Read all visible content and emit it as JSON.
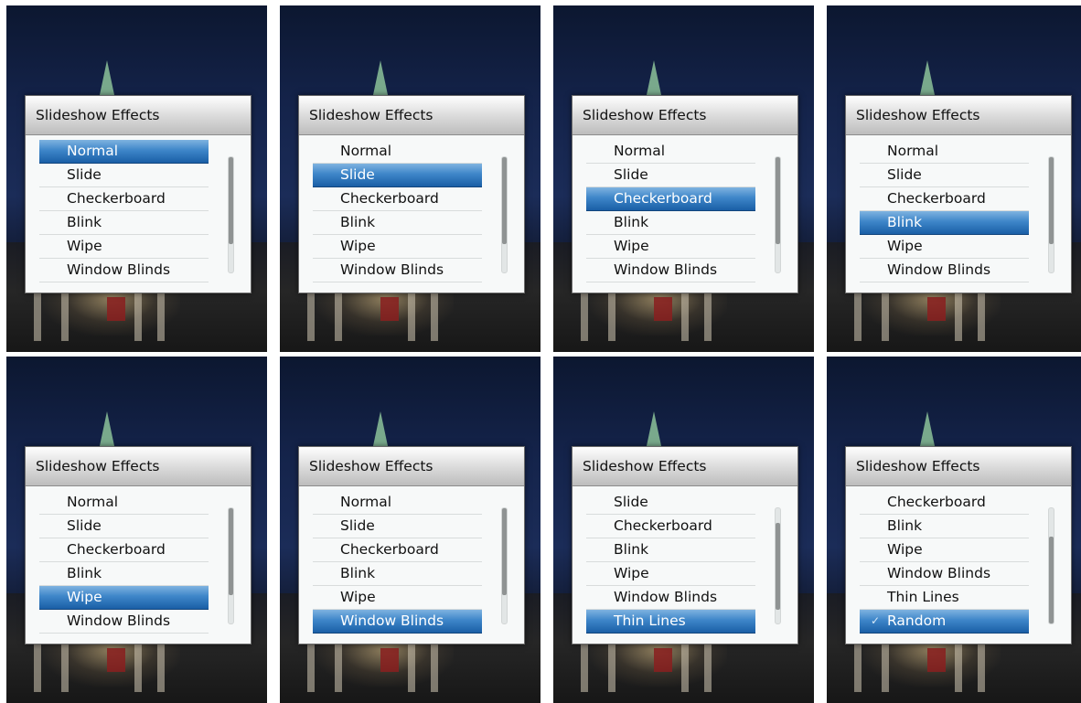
{
  "panels": [
    {
      "title": "Slideshow Effects",
      "items": [
        "Normal",
        "Slide",
        "Checkerboard",
        "Blink",
        "Wipe",
        "Window Blinds"
      ],
      "selected": 0,
      "checked": -1,
      "scroll_position": 0.0,
      "visible_fraction": 0.75
    },
    {
      "title": "Slideshow Effects",
      "items": [
        "Normal",
        "Slide",
        "Checkerboard",
        "Blink",
        "Wipe",
        "Window Blinds"
      ],
      "selected": 1,
      "checked": -1,
      "scroll_position": 0.0,
      "visible_fraction": 0.75
    },
    {
      "title": "Slideshow Effects",
      "items": [
        "Normal",
        "Slide",
        "Checkerboard",
        "Blink",
        "Wipe",
        "Window Blinds"
      ],
      "selected": 2,
      "checked": -1,
      "scroll_position": 0.0,
      "visible_fraction": 0.75
    },
    {
      "title": "Slideshow Effects",
      "items": [
        "Normal",
        "Slide",
        "Checkerboard",
        "Blink",
        "Wipe",
        "Window Blinds"
      ],
      "selected": 3,
      "checked": -1,
      "scroll_position": 0.0,
      "visible_fraction": 0.75
    },
    {
      "title": "Slideshow Effects",
      "items": [
        "Normal",
        "Slide",
        "Checkerboard",
        "Blink",
        "Wipe",
        "Window Blinds"
      ],
      "selected": 4,
      "checked": -1,
      "scroll_position": 0.0,
      "visible_fraction": 0.75
    },
    {
      "title": "Slideshow Effects",
      "items": [
        "Normal",
        "Slide",
        "Checkerboard",
        "Blink",
        "Wipe",
        "Window Blinds"
      ],
      "selected": 5,
      "checked": -1,
      "scroll_position": 0.0,
      "visible_fraction": 0.75
    },
    {
      "title": "Slideshow Effects",
      "items": [
        "Slide",
        "Checkerboard",
        "Blink",
        "Wipe",
        "Window Blinds",
        "Thin Lines"
      ],
      "selected": 5,
      "checked": -1,
      "scroll_position": 0.5,
      "visible_fraction": 0.75
    },
    {
      "title": "Slideshow Effects",
      "items": [
        "Checkerboard",
        "Blink",
        "Wipe",
        "Window Blinds",
        "Thin Lines",
        "Random"
      ],
      "selected": 5,
      "checked": 5,
      "check_glyph": "✓",
      "scroll_position": 1.0,
      "visible_fraction": 0.75
    }
  ],
  "colors": {
    "selection_top": "#7fb3e0",
    "selection_bottom": "#1a5fa6",
    "scroll_thumb": "#8f9393",
    "dialog_bg": "#f7f9f9"
  },
  "icons": {
    "spire": "church-spire",
    "check": "checkmark-icon"
  }
}
